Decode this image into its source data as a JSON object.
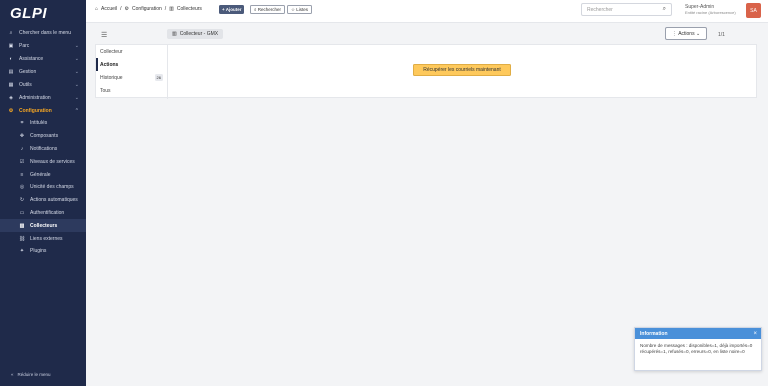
{
  "brand": {
    "logo": "GLPI"
  },
  "sidebar": {
    "items": [
      {
        "label": "Chercher dans le menu",
        "icon": "search-icon"
      },
      {
        "label": "Parc",
        "icon": "box-icon",
        "chevron": "⌄"
      },
      {
        "label": "Assistance",
        "icon": "headset-icon",
        "chevron": "⌄"
      },
      {
        "label": "Gestion",
        "icon": "wallet-icon",
        "chevron": "⌄"
      },
      {
        "label": "Outils",
        "icon": "briefcase-icon",
        "chevron": "⌄"
      },
      {
        "label": "Administration",
        "icon": "shield-icon",
        "chevron": "⌄"
      },
      {
        "label": "Configuration",
        "icon": "gear-icon",
        "chevron": "⌃"
      }
    ],
    "sub_items": [
      {
        "label": "Intitulés",
        "icon": "tag-icon"
      },
      {
        "label": "Composants",
        "icon": "components-icon"
      },
      {
        "label": "Notifications",
        "icon": "bell-icon"
      },
      {
        "label": "Niveaux de services",
        "icon": "checklist-icon"
      },
      {
        "label": "Générale",
        "icon": "sliders-icon"
      },
      {
        "label": "Unicité des champs",
        "icon": "fingerprint-icon"
      },
      {
        "label": "Actions automatiques",
        "icon": "refresh-icon"
      },
      {
        "label": "Authentification",
        "icon": "id-card-icon"
      },
      {
        "label": "Collecteurs",
        "icon": "inbox-icon"
      },
      {
        "label": "Liens externes",
        "icon": "link-icon"
      },
      {
        "label": "Plugins",
        "icon": "puzzle-icon"
      }
    ],
    "collapse_label": "Réduire le menu"
  },
  "topbar": {
    "breadcrumb": [
      "Accueil",
      "/",
      "Configuration",
      "/",
      "Collecteurs"
    ],
    "add_label": "+ Ajouter",
    "search_label": "Rechercher",
    "lists_label": "Listes",
    "search_placeholder": "Rechercher",
    "user_name": "Super-Admin",
    "user_entity": "Entité racine (Arborescence)",
    "avatar_initials": "SA"
  },
  "main": {
    "item_title": "Collecteur - GMX",
    "actions_label": "Actions",
    "pager": "1/1",
    "tabs": [
      {
        "label": "Collecteur"
      },
      {
        "label": "Actions"
      },
      {
        "label": "Historique",
        "badge": "26"
      },
      {
        "label": "Tous"
      }
    ],
    "fetch_button": "Récupérer les courriels maintenant"
  },
  "toast": {
    "title": "Information",
    "message": "Nombre de messages : disponibles=1, déjà importés=0 récupérés=1, refusés=0, erreurs=0, en liste noire=0"
  },
  "colors": {
    "sidebar_bg": "#1f2a4a",
    "accent": "#f5a623",
    "button_warning": "#fec95c",
    "toast_header": "#4a90d9"
  }
}
